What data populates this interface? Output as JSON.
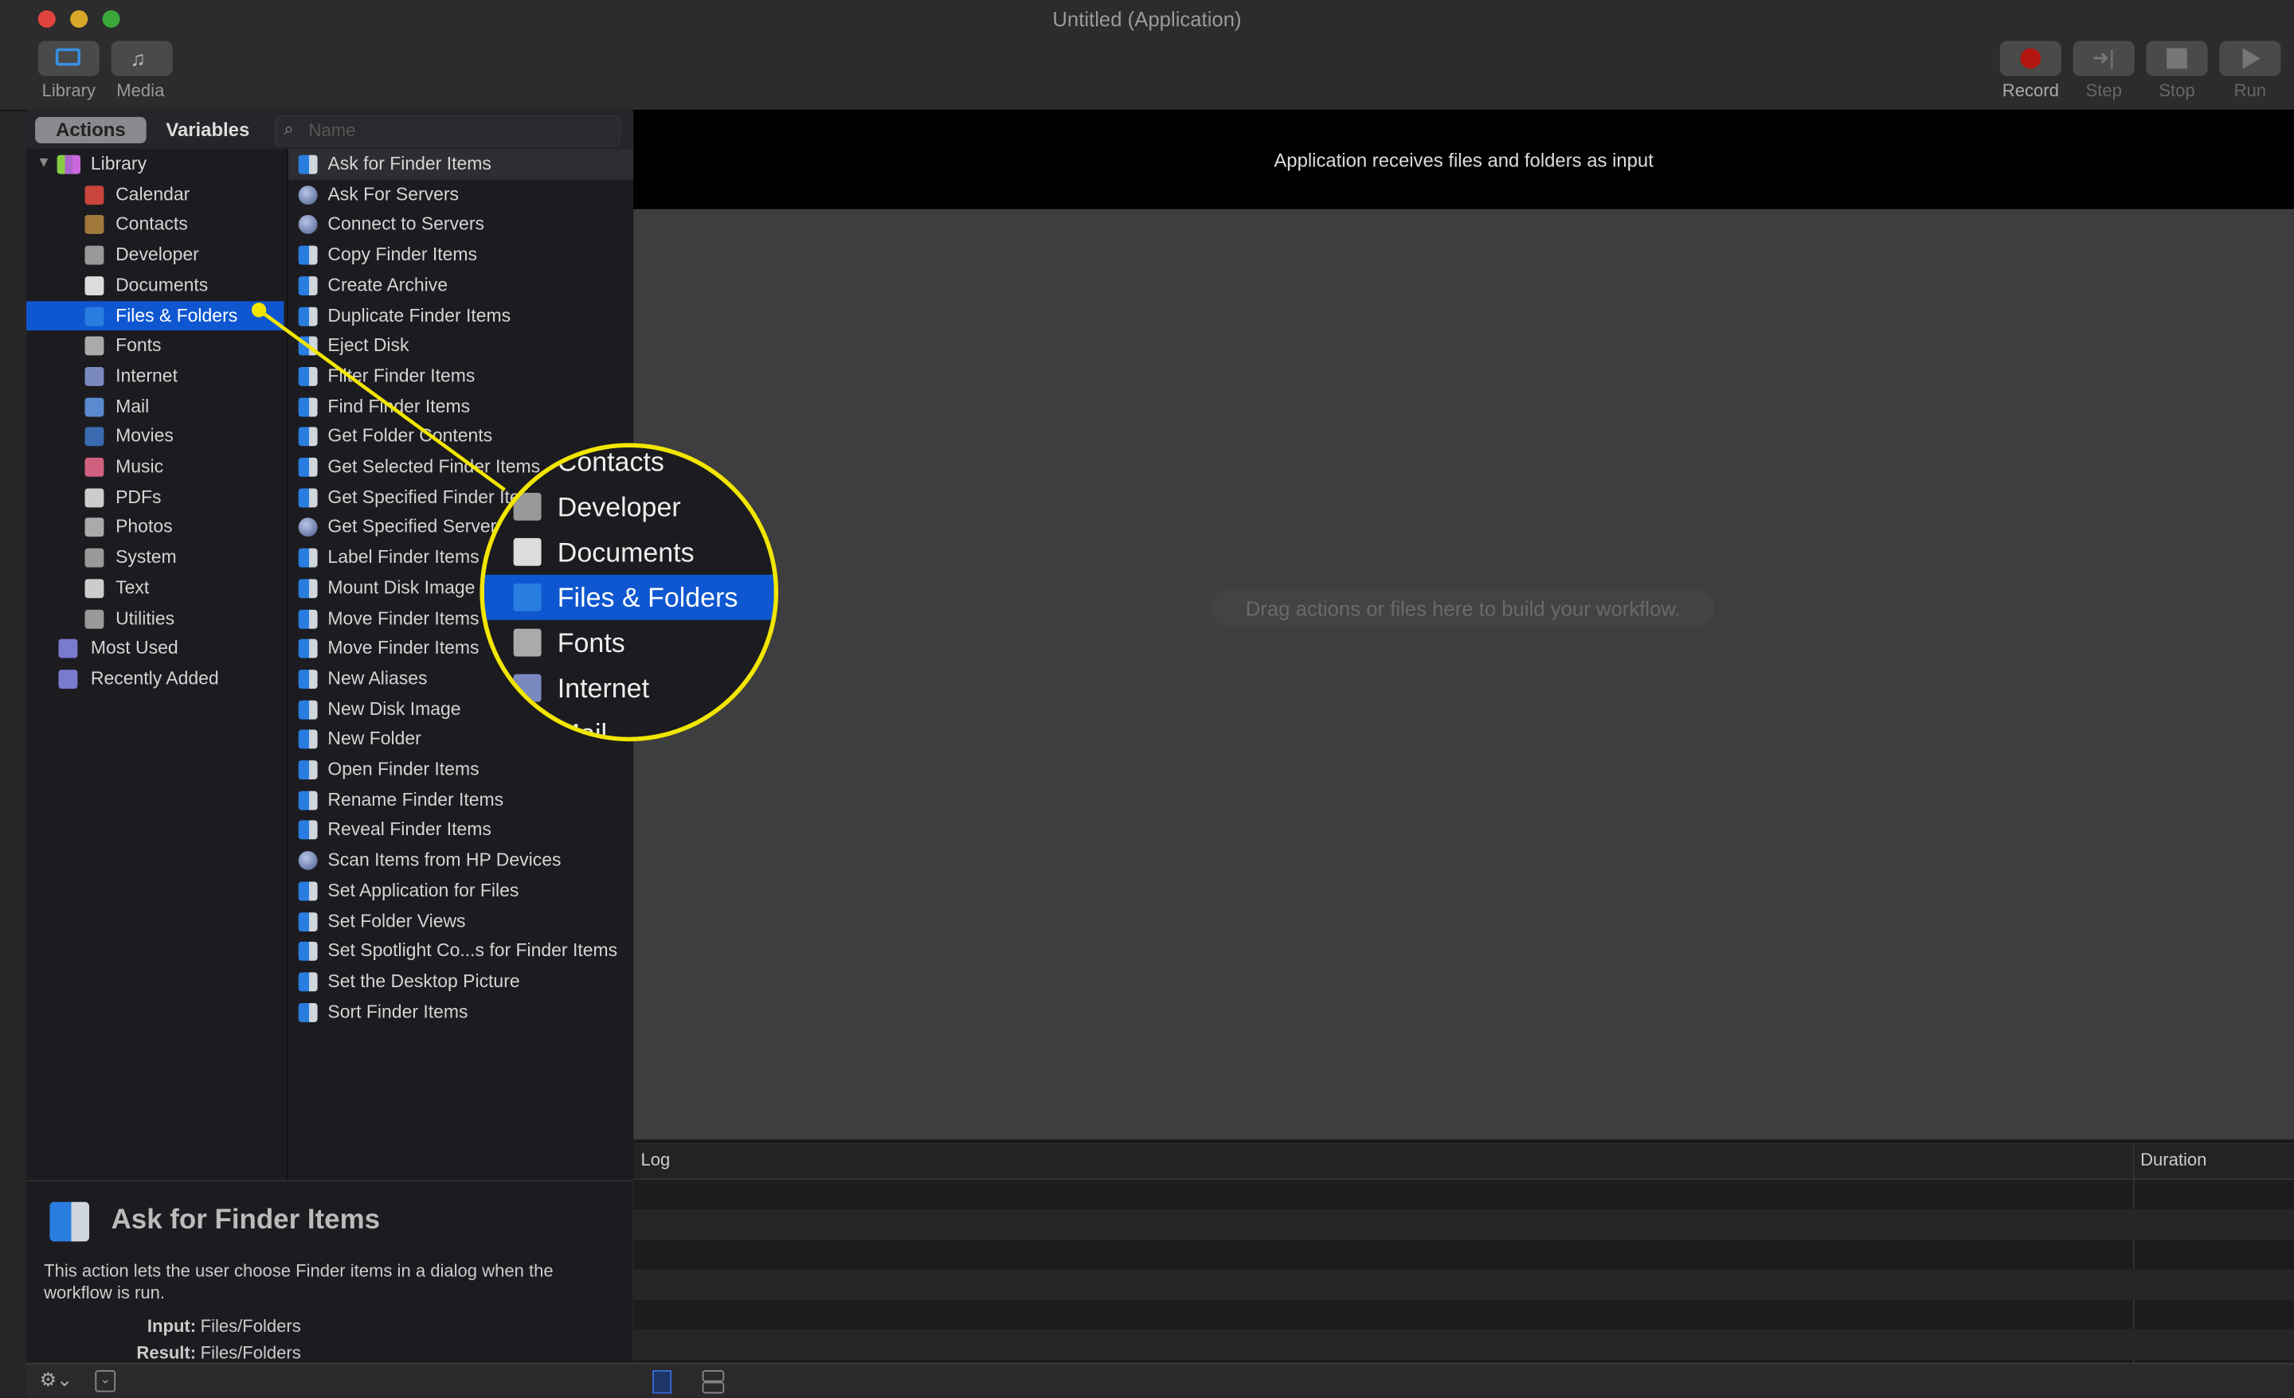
{
  "window": {
    "title": "Untitled (Application)"
  },
  "toolbar": {
    "library": "Library",
    "media": "Media",
    "record": "Record",
    "step": "Step",
    "stop": "Stop",
    "run": "Run",
    "record_color": "#b3150f"
  },
  "tabs": {
    "actions": "Actions",
    "variables": "Variables"
  },
  "search": {
    "placeholder": "Name"
  },
  "library": {
    "root": "Library",
    "items": [
      {
        "label": "Calendar",
        "icon": "calendar-icon"
      },
      {
        "label": "Contacts",
        "icon": "contacts-icon"
      },
      {
        "label": "Developer",
        "icon": "developer-icon"
      },
      {
        "label": "Documents",
        "icon": "documents-icon"
      },
      {
        "label": "Files & Folders",
        "icon": "finder-icon",
        "selected": true
      },
      {
        "label": "Fonts",
        "icon": "fonts-icon"
      },
      {
        "label": "Internet",
        "icon": "globe-icon"
      },
      {
        "label": "Mail",
        "icon": "mail-icon"
      },
      {
        "label": "Movies",
        "icon": "movies-icon"
      },
      {
        "label": "Music",
        "icon": "music-icon"
      },
      {
        "label": "PDFs",
        "icon": "pdf-icon"
      },
      {
        "label": "Photos",
        "icon": "photos-icon"
      },
      {
        "label": "System",
        "icon": "system-icon"
      },
      {
        "label": "Text",
        "icon": "text-icon"
      },
      {
        "label": "Utilities",
        "icon": "utilities-icon"
      }
    ],
    "extra": [
      {
        "label": "Most Used",
        "icon": "folder-icon"
      },
      {
        "label": "Recently Added",
        "icon": "folder-icon"
      }
    ]
  },
  "actions": [
    {
      "label": "Ask for Finder Items",
      "icon": "finder"
    },
    {
      "label": "Ask For Servers",
      "icon": "globe"
    },
    {
      "label": "Connect to Servers",
      "icon": "globe"
    },
    {
      "label": "Copy Finder Items",
      "icon": "finder"
    },
    {
      "label": "Create Archive",
      "icon": "finder"
    },
    {
      "label": "Duplicate Finder Items",
      "icon": "finder"
    },
    {
      "label": "Eject Disk",
      "icon": "finder"
    },
    {
      "label": "Filter Finder Items",
      "icon": "finder"
    },
    {
      "label": "Find Finder Items",
      "icon": "finder"
    },
    {
      "label": "Get Folder Contents",
      "icon": "finder"
    },
    {
      "label": "Get Selected Finder Items",
      "icon": "finder"
    },
    {
      "label": "Get Specified Finder Items",
      "icon": "finder"
    },
    {
      "label": "Get Specified Servers",
      "icon": "globe"
    },
    {
      "label": "Label Finder Items",
      "icon": "finder"
    },
    {
      "label": "Mount Disk Image",
      "icon": "finder"
    },
    {
      "label": "Move Finder Items",
      "icon": "finder"
    },
    {
      "label": "Move Finder Items",
      "icon": "finder"
    },
    {
      "label": "New Aliases",
      "icon": "finder"
    },
    {
      "label": "New Disk Image",
      "icon": "finder"
    },
    {
      "label": "New Folder",
      "icon": "finder"
    },
    {
      "label": "Open Finder Items",
      "icon": "finder"
    },
    {
      "label": "Rename Finder Items",
      "icon": "finder"
    },
    {
      "label": "Reveal Finder Items",
      "icon": "finder"
    },
    {
      "label": "Scan Items from HP Devices",
      "icon": "globe"
    },
    {
      "label": "Set Application for Files",
      "icon": "finder"
    },
    {
      "label": "Set Folder Views",
      "icon": "finder"
    },
    {
      "label": "Set Spotlight Co...s for Finder Items",
      "icon": "finder"
    },
    {
      "label": "Set the Desktop Picture",
      "icon": "finder"
    },
    {
      "label": "Sort Finder Items",
      "icon": "finder"
    }
  ],
  "description": {
    "title": "Ask for Finder Items",
    "text": "This action lets the user choose Finder items in a dialog when the workflow is run.",
    "input_label": "Input:",
    "input_value": "Files/Folders",
    "result_label": "Result:",
    "result_value": "Files/Folders"
  },
  "workflow": {
    "header": "Application receives files and folders as input",
    "hint": "Drag actions or files here to build your workflow."
  },
  "log": {
    "col_log": "Log",
    "col_duration": "Duration"
  },
  "magnifier": {
    "items": [
      "Contacts",
      "Developer",
      "Documents",
      "Files & Folders",
      "Fonts",
      "Internet",
      "Mail"
    ],
    "selected": "Files & Folders",
    "ring_color": "#f2e600"
  }
}
